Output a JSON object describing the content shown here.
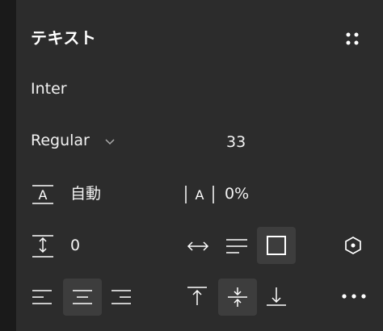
{
  "panel": {
    "title": "テキスト",
    "font_family": "Inter",
    "font_weight": "Regular",
    "font_size": "33",
    "line_height": "自動",
    "letter_spacing": "0%",
    "paragraph_spacing": "0"
  },
  "icons": {
    "styles": "four-dots-icon",
    "line_height": "line-height-icon",
    "letter_spacing": "letter-spacing-icon",
    "paragraph_spacing": "paragraph-spacing-icon",
    "auto_width": "auto-width-icon",
    "auto_height": "auto-height-icon",
    "fixed_size": "fixed-size-icon",
    "truncate": "hexagon-settings-icon",
    "align_left": "align-left-icon",
    "align_center": "align-center-icon",
    "align_right": "align-right-icon",
    "align_top": "align-top-icon",
    "align_middle": "align-middle-icon",
    "align_bottom": "align-bottom-icon",
    "more": "more-icon"
  },
  "colors": {
    "panel_bg": "#2c2c2c",
    "selected_bg": "#3d3d3d",
    "text": "#ffffff"
  }
}
